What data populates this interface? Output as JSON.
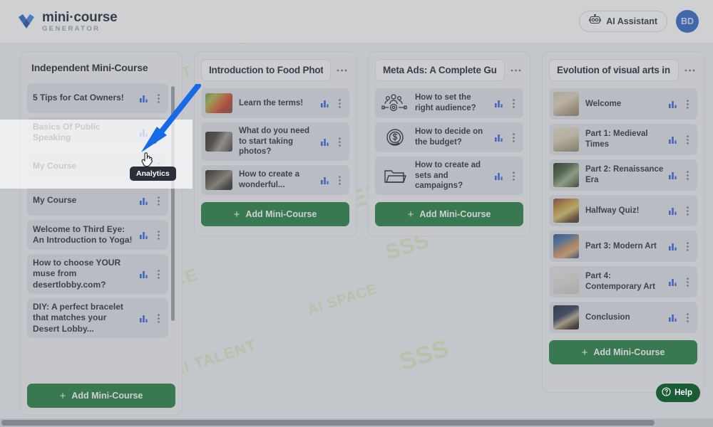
{
  "header": {
    "logo_title": "mini·course",
    "logo_subtitle": "GENERATOR",
    "logo_icon": "minicourse-logo-icon",
    "ai_assistant_label": "AI Assistant",
    "ai_assistant_icon": "robot-icon",
    "avatar_initials": "BD"
  },
  "overlay": {
    "tooltip_label": "Analytics",
    "arrow_icon": "pointer-arrow-icon",
    "cursor_icon": "hand-pointer-cursor"
  },
  "help": {
    "label": "Help",
    "icon": "question-circle-icon"
  },
  "colors": {
    "accent_green": "#1e7c3c",
    "help_green": "#1a5c36",
    "avatar_blue": "#2a62c4",
    "analytics_blue": "#2b5fd9",
    "card_bg": "#dfe3e9",
    "column_bg": "#f1f2f4"
  },
  "icons": {
    "analytics": "bar-chart-icon",
    "more_vertical": "more-vertical-icon",
    "more_horizontal": "more-horizontal-icon",
    "add": "plus-icon"
  },
  "columns": [
    {
      "title": "Independent Mini-Course",
      "title_boxed": false,
      "has_menu": false,
      "add_label": "Add Mini-Course",
      "cards": [
        {
          "title": "5 Tips for Cat Owners!",
          "media": "none"
        },
        {
          "title": "Basics Of Public Speaking",
          "media": "none"
        },
        {
          "title": "My Course",
          "media": "none"
        },
        {
          "title": "My Course",
          "media": "none"
        },
        {
          "title": "Welcome to Third Eye: An Introduction to Yoga!",
          "media": "none"
        },
        {
          "title": "How to choose YOUR muse from desertlobby.com?",
          "media": "none"
        },
        {
          "title": "DIY: A perfect bracelet that matches your Desert Lobby...",
          "media": "none"
        }
      ]
    },
    {
      "title": "Introduction to Food Photogr",
      "title_boxed": true,
      "has_menu": true,
      "add_label": "Add Mini-Course",
      "cards": [
        {
          "title": "Learn the terms!",
          "media": "photo-vegetables-thumb"
        },
        {
          "title": "What do you need to start taking photos?",
          "media": "photo-dark-table-thumb"
        },
        {
          "title": "How to create a wonderful...",
          "media": "photo-plating-thumb"
        }
      ]
    },
    {
      "title": "Meta Ads: A Complete Guide",
      "title_boxed": true,
      "has_menu": true,
      "add_label": "Add Mini-Course",
      "cards": [
        {
          "title": "How to set the right audience?",
          "media": "audience-target-icon"
        },
        {
          "title": "How to decide on the budget?",
          "media": "dollar-circle-icon"
        },
        {
          "title": "How to create ad sets and campaigns?",
          "media": "folder-icon"
        }
      ]
    },
    {
      "title": "Evolution of visual arts in Eur",
      "title_boxed": true,
      "has_menu": true,
      "add_label": "Add Mini-Course",
      "cards": [
        {
          "title": "Welcome",
          "media": "creation-of-adam-thumb"
        },
        {
          "title": "Part 1: Medieval Times",
          "media": "medieval-cat-thumb"
        },
        {
          "title": "Part 2: Renaissance Era",
          "media": "renaissance-thumb"
        },
        {
          "title": "Halfway Quiz!",
          "media": "icon-painting-thumb"
        },
        {
          "title": "Part 3: Modern Art",
          "media": "van-gogh-thumb"
        },
        {
          "title": "Part 4: Contemporary Art",
          "media": "banksy-balloon-thumb"
        },
        {
          "title": "Conclusion",
          "media": "modern-figure-thumb"
        }
      ]
    }
  ]
}
